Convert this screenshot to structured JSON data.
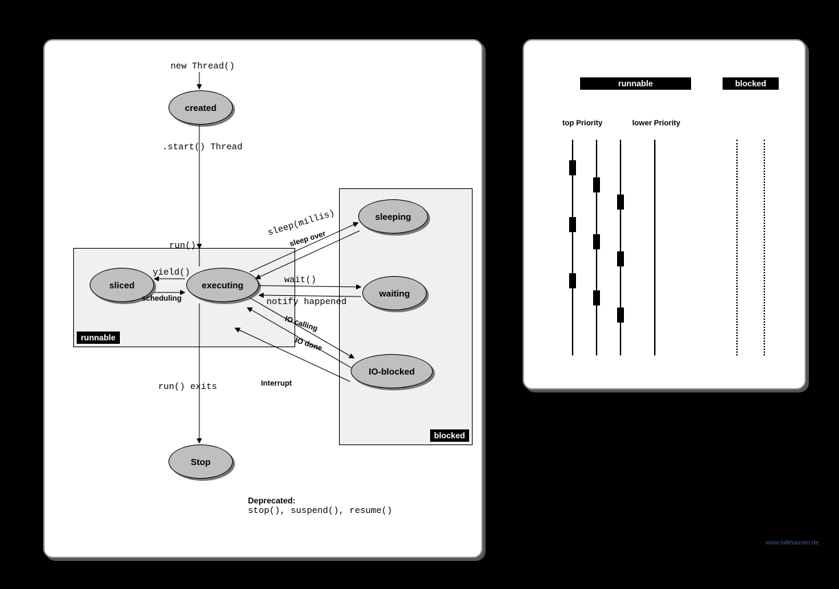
{
  "left": {
    "top_label": "new Thread()",
    "nodes": {
      "created": "created",
      "sliced": "sliced",
      "executing": "executing",
      "sleeping": "sleeping",
      "waiting": "waiting",
      "ioblocked": "IO-blocked",
      "stop": "Stop"
    },
    "edges": {
      "start": ".start() Thread",
      "run": "run()",
      "yield": "yield()",
      "scheduling": "scheduling",
      "sleep": "sleep(millis)",
      "sleep_over": "sleep over",
      "wait": "wait()",
      "notify": "notify happened",
      "io_call": "IO calling",
      "io_done": "IO done",
      "interrupt": "Interrupt",
      "run_exits": "run() exits"
    },
    "groups": {
      "runnable": "runnable",
      "blocked": "blocked"
    },
    "deprecated_title": "Deprecated:",
    "deprecated_body": "stop(), suspend(), resume()"
  },
  "right": {
    "tag_runnable": "runnable",
    "tag_blocked": "blocked",
    "top_priority": "top Priority",
    "lower_priority": "lower Priority"
  },
  "watermark": "www.falkhausen.de"
}
